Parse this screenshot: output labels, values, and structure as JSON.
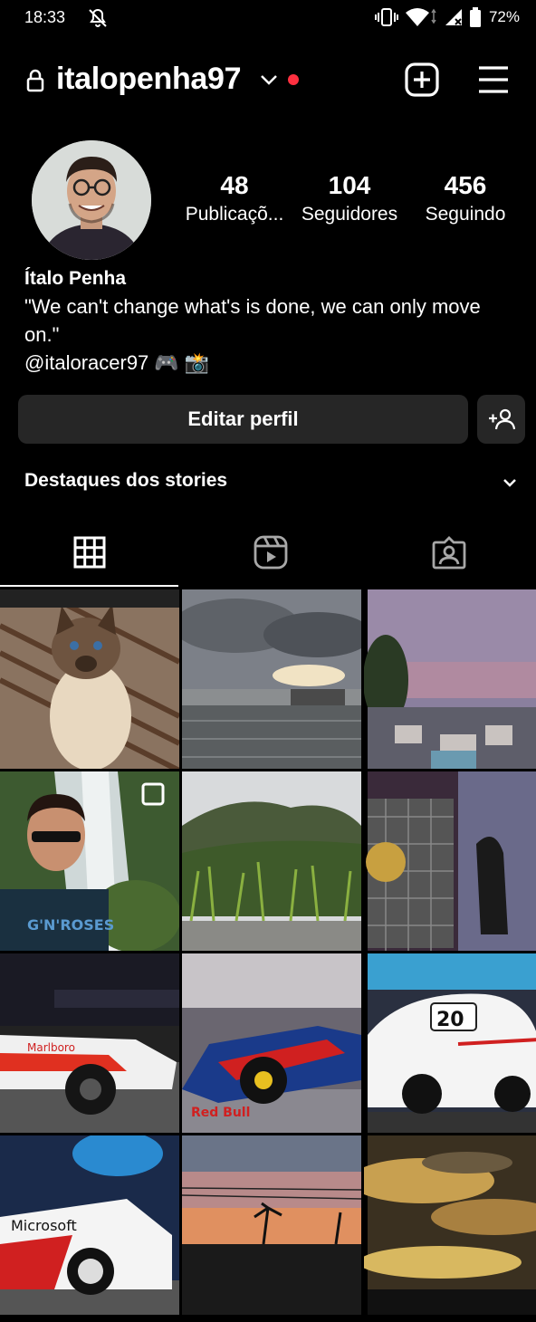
{
  "status_bar": {
    "time": "18:33",
    "battery": "72%"
  },
  "header": {
    "username": "italopenha97"
  },
  "profile": {
    "stats": [
      {
        "value": "48",
        "label": "Publicaçõ..."
      },
      {
        "value": "104",
        "label": "Seguidores"
      },
      {
        "value": "456",
        "label": "Seguindo"
      }
    ],
    "name": "Ítalo Penha",
    "bio": "\"We can't change what's is done, we can only move on.\"",
    "link": "@italoracer97 🎮 📸"
  },
  "actions": {
    "edit_profile": "Editar perfil"
  },
  "highlights": {
    "title": "Destaques dos stories"
  },
  "colors": {
    "accent_dot": "#ff3040",
    "button_bg": "#262626"
  },
  "tabs": [
    "grid-icon",
    "reels-icon",
    "tagged-icon"
  ]
}
